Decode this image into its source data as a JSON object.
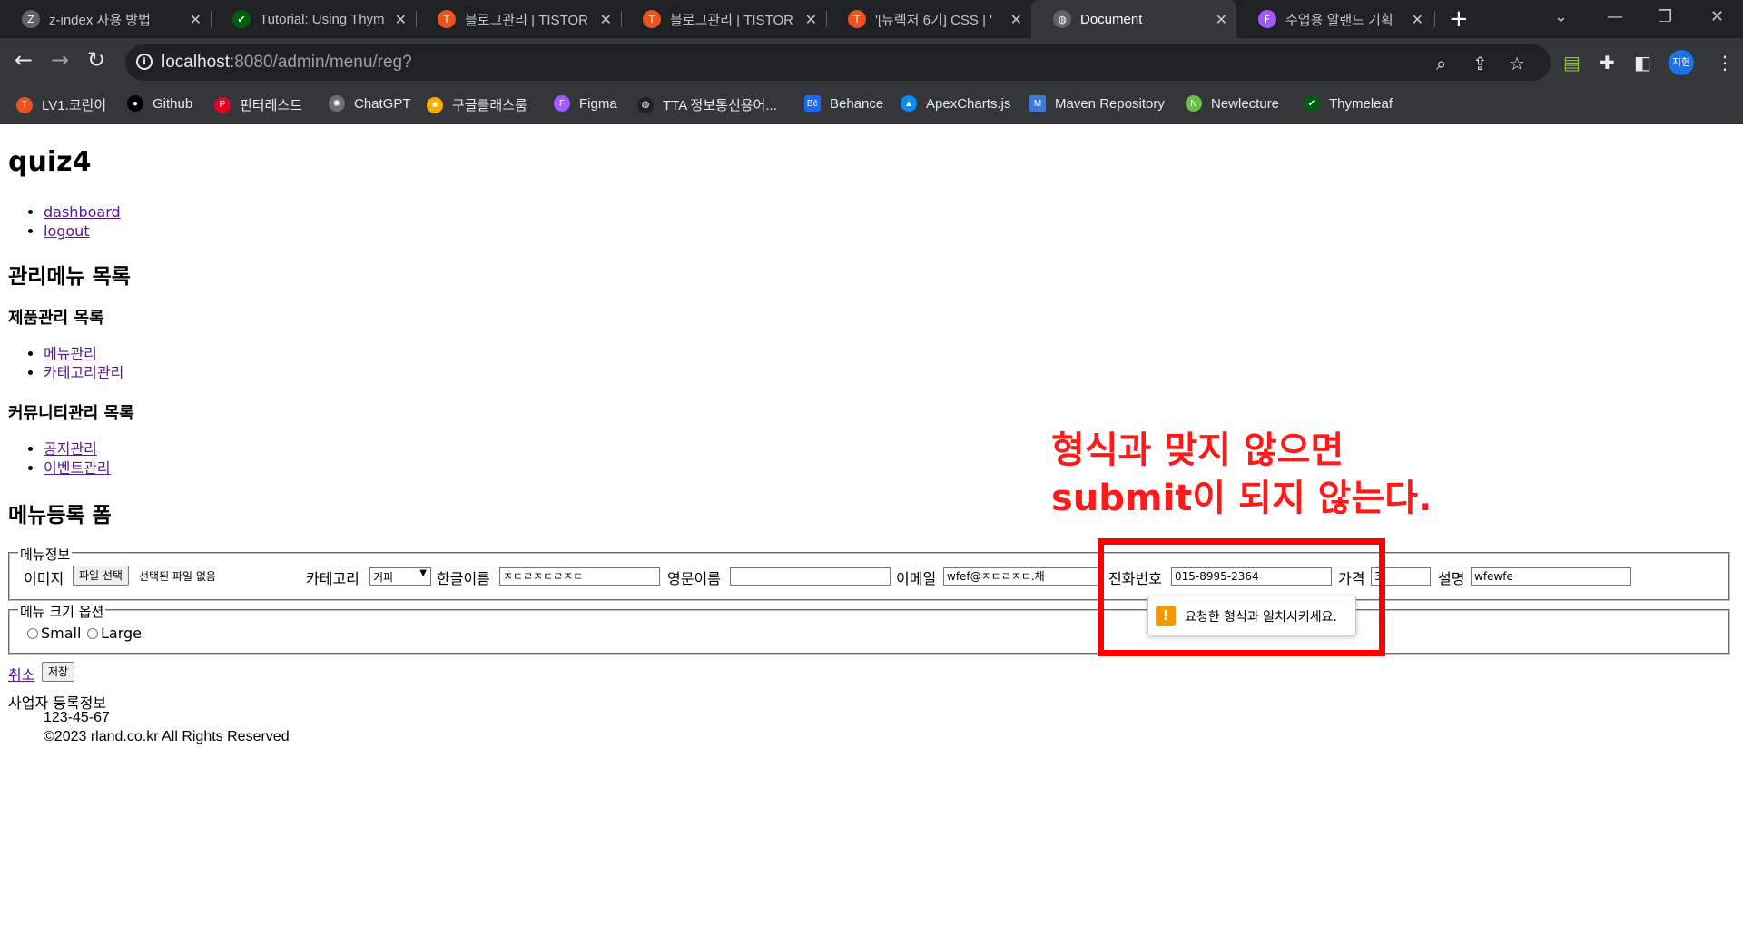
{
  "browser": {
    "tabs": [
      {
        "title": "z-index 사용 방법",
        "favicon": "notion-icon",
        "color": "#5f6368",
        "glyph": "Z"
      },
      {
        "title": "Tutorial: Using Thym",
        "favicon": "thymeleaf-icon",
        "color": "#005f0f",
        "glyph": "✔"
      },
      {
        "title": "블로그관리 | TISTOR",
        "favicon": "tistory-icon",
        "color": "#eb531f",
        "glyph": "T"
      },
      {
        "title": "블로그관리 | TISTOR",
        "favicon": "tistory-icon",
        "color": "#eb531f",
        "glyph": "T"
      },
      {
        "title": "'[뉴렉처 6기] CSS | '",
        "favicon": "tistory-icon",
        "color": "#eb531f",
        "glyph": "T"
      },
      {
        "title": "Document",
        "favicon": "globe-icon",
        "color": "#5f6368",
        "glyph": "◍",
        "active": true
      },
      {
        "title": "수업용 알랜드 기획",
        "favicon": "figma-icon",
        "color": "#a259ff",
        "glyph": "F"
      }
    ],
    "new_tab_glyph": "+",
    "url_host": "localhost",
    "url_rest": ":8080/admin/menu/reg?",
    "bookmarks": [
      {
        "label": "LV1.코린이",
        "icon": "tistory-icon",
        "color": "#eb531f",
        "glyph": "T"
      },
      {
        "label": "Github",
        "icon": "github-icon",
        "color": "#000000",
        "glyph": "●"
      },
      {
        "label": "핀터레스트",
        "icon": "pinterest-icon",
        "color": "#e60023",
        "glyph": "P"
      },
      {
        "label": "ChatGPT",
        "icon": "chatgpt-icon",
        "color": "#6e6e6e",
        "glyph": "✺"
      },
      {
        "label": "구글클래스룸",
        "icon": "classroom-icon",
        "color": "#f9ab00",
        "glyph": "■"
      },
      {
        "label": "Figma",
        "icon": "figma-icon",
        "color": "#a259ff",
        "glyph": "F"
      },
      {
        "label": "TTA 정보통신용어...",
        "icon": "globe-icon",
        "color": "#202124",
        "glyph": "◍"
      },
      {
        "label": "Behance",
        "icon": "behance-icon",
        "color": "#1769ff",
        "glyph": "Bē"
      },
      {
        "label": "ApexCharts.js",
        "icon": "apexcharts-icon",
        "color": "#008ffb",
        "glyph": "▲"
      },
      {
        "label": "Maven Repository",
        "icon": "maven-icon",
        "color": "#3c78d8",
        "glyph": "M"
      },
      {
        "label": "Newlecture",
        "icon": "newlecture-icon",
        "color": "#6abf4b",
        "glyph": "N"
      },
      {
        "label": "Thymeleaf",
        "icon": "thymeleaf-icon",
        "color": "#005f0f",
        "glyph": "✔"
      }
    ],
    "profile_label": "지현"
  },
  "page": {
    "site_title": "quiz4",
    "top_nav": [
      "dashboard",
      "logout"
    ],
    "admin_menu_heading": "관리메뉴 목록",
    "product_heading": "제품관리 목록",
    "product_links": [
      "메뉴관리",
      "카테고리관리"
    ],
    "community_heading": "커뮤니티관리 목록",
    "community_links": [
      "공지관리",
      "이벤트관리"
    ],
    "form_heading": "메뉴등록 폼"
  },
  "form": {
    "menu_info_legend": "메뉴정보",
    "image_label": "이미지",
    "file_button": "파일 선택",
    "file_status": "선택된 파일 없음",
    "category_label": "카테고리",
    "category_value": "커피",
    "korean_name_label": "한글이름",
    "korean_name_value": "ㅈㄷㄹㅈㄷㄹㅈㄷ",
    "english_name_label": "영문이름",
    "english_name_value": "",
    "email_label": "이메일",
    "email_value": "wfef@ㅈㄷㄹㅈㄷ.채",
    "phone_label": "전화번호",
    "phone_value": "015-8995-2364",
    "price_label": "가격",
    "price_value": "3",
    "description_label": "설명",
    "description_value": "wfewfe",
    "size_legend": "메뉴 크기 옵션",
    "size_options": [
      "Small",
      "Large"
    ],
    "cancel_link": "취소",
    "save_button": "저장",
    "validation_message": "요청한 형식과 일치시키세요."
  },
  "footer": {
    "title": "사업자 등록정보",
    "business_number": "123-45-67",
    "copyright": "©2023 rland.co.kr All Rights Reserved"
  },
  "annotation": {
    "line1": "형식과 맞지 않으면",
    "line2": "submit이 되지 않는다.",
    "color": "#ff0000"
  }
}
